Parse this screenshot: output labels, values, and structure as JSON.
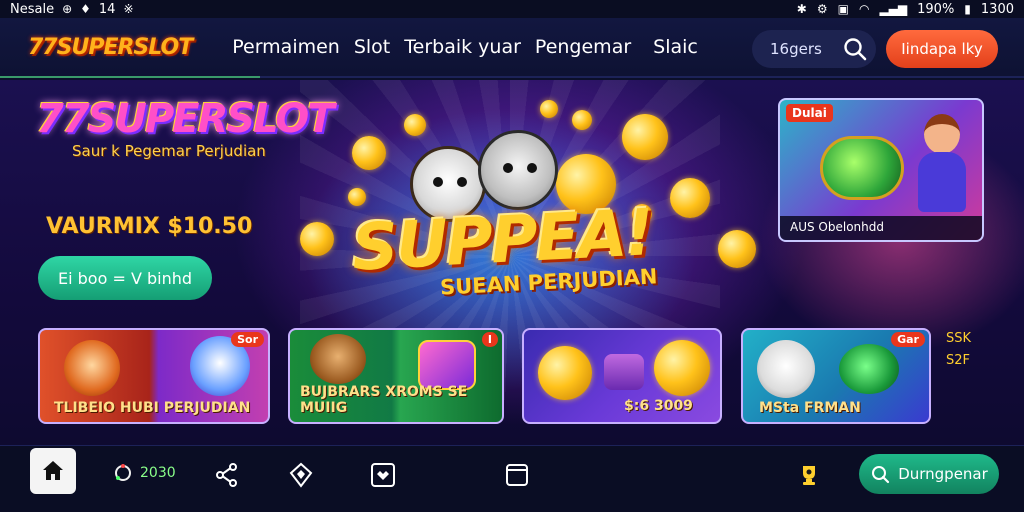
{
  "status_bar": {
    "left_text": "Nesale",
    "time_left": "14",
    "battery": "190%",
    "time_right": "1300"
  },
  "header": {
    "logo": "77SUPERSLOT",
    "nav_items": [
      "Permaimen",
      "Slot",
      "Terbaik yuar",
      "Pengemar",
      "Slaic"
    ],
    "search_placeholder": "16gers",
    "action_button": "Iindapa lky"
  },
  "hero": {
    "logo": "77SUPERSLOT",
    "logo_sub": "Saur k Pegemar Perjudian",
    "promo_text": "VAURMIX $10.50",
    "cta_button": "Ei boo = V binhd",
    "title": "SUPPEA!",
    "subtitle": "SUEAN PERJUDIAN",
    "feature_card": {
      "badge": "Dulai",
      "caption": "AUS Obelonhdd"
    }
  },
  "games": [
    {
      "label": "TLIBEIO  HUBI PERJUDIAN",
      "badge": "Sor"
    },
    {
      "label": "BUJBRARS XROMS  SE MUIIG",
      "badge": "I"
    },
    {
      "label": "$:6 3009",
      "badge": ""
    },
    {
      "label": "MSta  FRMAN",
      "badge": "Gar"
    }
  ],
  "side_text": {
    "line1": "SSK",
    "line2": "S2F"
  },
  "bottom_nav": {
    "home": "home",
    "balance": "2030",
    "cta": "Durngpenar"
  },
  "colors": {
    "accent": "#e9361c",
    "green": "#1fb98a",
    "gold": "#ffcf2e",
    "background": "#0b0f2a"
  }
}
